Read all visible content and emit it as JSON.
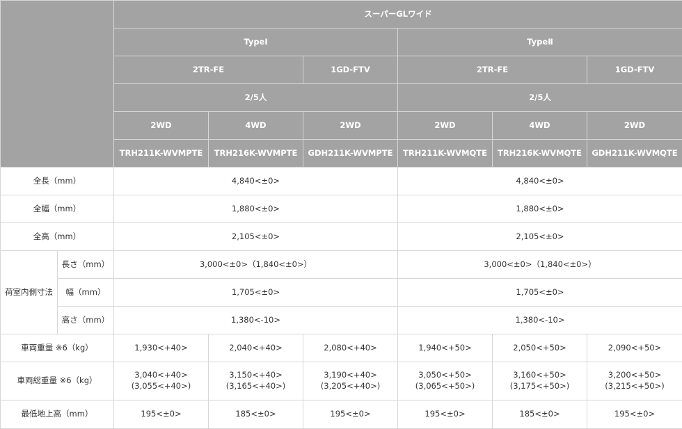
{
  "header": {
    "grade": "スーパーGLワイド",
    "types": [
      "TypeⅠ",
      "TypeⅡ"
    ],
    "engines": [
      "2TR-FE",
      "1GD-FTV",
      "2TR-FE",
      "1GD-FTV"
    ],
    "seating": [
      "2/5人",
      "2/5人"
    ],
    "drive": [
      "2WD",
      "4WD",
      "2WD",
      "2WD",
      "4WD",
      "2WD"
    ],
    "models": [
      "TRH211K-WVMPTE",
      "TRH216K-WVMPTE",
      "GDH211K-WVMPTE",
      "TRH211K-WVMQTE",
      "TRH216K-WVMQTE",
      "GDH211K-WVMQTE"
    ]
  },
  "rows": {
    "length": {
      "label": "全長（mm）",
      "type1": "4,840<±0>",
      "type2": "4,840<±0>"
    },
    "width": {
      "label": "全幅（mm）",
      "type1": "1,880<±0>",
      "type2": "1,880<±0>"
    },
    "height": {
      "label": "全高（mm）",
      "type1": "2,105<±0>",
      "type2": "2,105<±0>"
    },
    "cargo": {
      "group_label": "荷室内側寸法",
      "length": {
        "label": "長さ（mm）",
        "type1": "3,000<±0>（1,840<±0>）",
        "type2": "3,000<±0>（1,840<±0>）"
      },
      "width": {
        "label": "幅（mm）",
        "type1": "1,705<±0>",
        "type2": "1,705<±0>"
      },
      "height": {
        "label": "高さ（mm）",
        "type1": "1,380<-10>",
        "type2": "1,380<-10>"
      }
    },
    "weight": {
      "label": "車両重量 ※6（kg）",
      "values": [
        "1,930<+40>",
        "2,040<+40>",
        "2,080<+40>",
        "1,940<+50>",
        "2,050<+50>",
        "2,090<+50>"
      ]
    },
    "gross_weight": {
      "label": "車両総重量 ※6（kg）",
      "values": [
        [
          "3,040<+40>",
          "(3,055<+40>)"
        ],
        [
          "3,150<+40>",
          "(3,165<+40>)"
        ],
        [
          "3,190<+40>",
          "(3,205<+40>)"
        ],
        [
          "3,050<+50>",
          "(3,065<+50>)"
        ],
        [
          "3,160<+50>",
          "(3,175<+50>)"
        ],
        [
          "3,200<+50>",
          "(3,215<+50>)"
        ]
      ]
    },
    "ground_clearance": {
      "label": "最低地上高（mm）",
      "values": [
        "195<±0>",
        "185<±0>",
        "195<±0>",
        "195<±0>",
        "185<±0>",
        "195<±0>"
      ]
    }
  }
}
